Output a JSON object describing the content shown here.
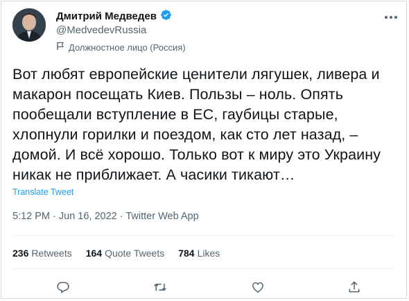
{
  "author": {
    "name": "Дмитрий Медведев",
    "handle": "@MedvedevRussia",
    "label": "Должностное лицо (Россия)"
  },
  "tweet": {
    "text": "Вот любят европейские ценители лягушек, ливера и\nмакарон посещать Киев. Пользы – ноль. Опять\nпообещали вступление в ЕС, гаубицы старые,\nхлопнули горилки и поездом, как сто лет назад, –\nдомой. И всё хорошо. Только вот к миру это Украину\nникак не приближает. А часики тикают…",
    "translate": "Translate Tweet",
    "meta": "5:12 PM · Jun 16, 2022 · Twitter Web App"
  },
  "stats": {
    "retweets_count": "236",
    "retweets_label": "Retweets",
    "quotes_count": "164",
    "quotes_label": "Quote Tweets",
    "likes_count": "784",
    "likes_label": "Likes"
  },
  "colors": {
    "verified": "#1d9bf0",
    "link": "#1d9bf0",
    "muted": "#536471"
  }
}
